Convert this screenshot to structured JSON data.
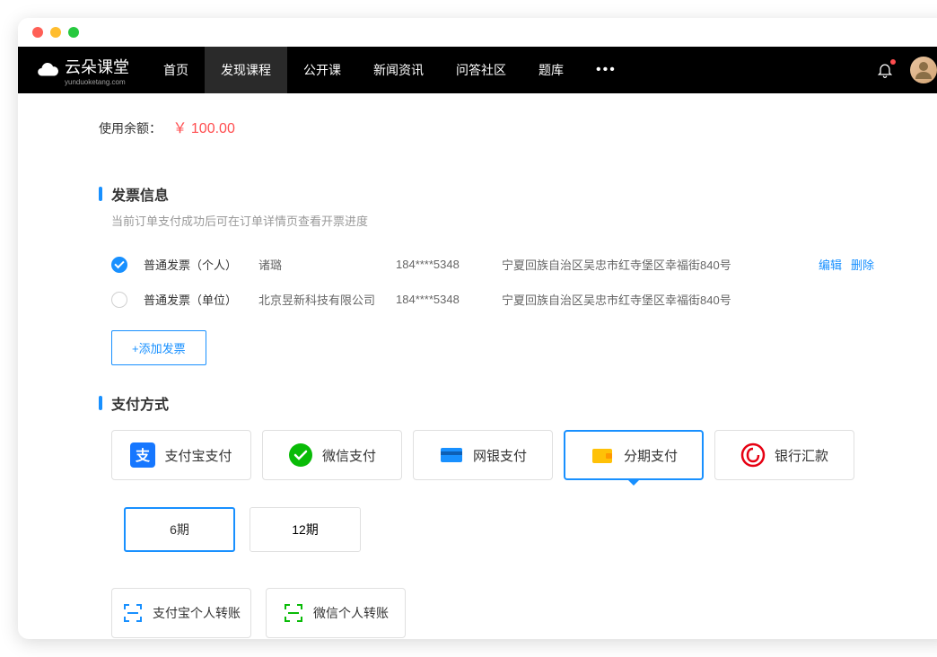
{
  "nav": {
    "brand": "云朵课堂",
    "brand_sub": "yunduoketang.com",
    "items": [
      "首页",
      "发现课程",
      "公开课",
      "新闻资讯",
      "问答社区",
      "题库"
    ],
    "active_index": 1
  },
  "balance": {
    "label": "使用余额：",
    "amount": "￥ 100.00"
  },
  "invoice": {
    "title": "发票信息",
    "subtitle": "当前订单支付成功后可在订单详情页查看开票进度",
    "rows": [
      {
        "type": "普通发票（个人）",
        "name": "诸璐",
        "phone": "184****5348",
        "address": "宁夏回族自治区吴忠市红寺堡区幸福街840号",
        "selected": true
      },
      {
        "type": "普通发票（单位）",
        "name": "北京昱新科技有限公司",
        "phone": "184****5348",
        "address": "宁夏回族自治区吴忠市红寺堡区幸福街840号",
        "selected": false
      }
    ],
    "edit_label": "编辑",
    "delete_label": "删除",
    "add_label": "+添加发票"
  },
  "payment": {
    "title": "支付方式",
    "methods": [
      "支付宝支付",
      "微信支付",
      "网银支付",
      "分期支付",
      "银行汇款"
    ],
    "selected_index": 3,
    "installments": [
      "6期",
      "12期"
    ],
    "installment_selected": 0,
    "transfers": [
      "支付宝个人转账",
      "微信个人转账"
    ]
  }
}
